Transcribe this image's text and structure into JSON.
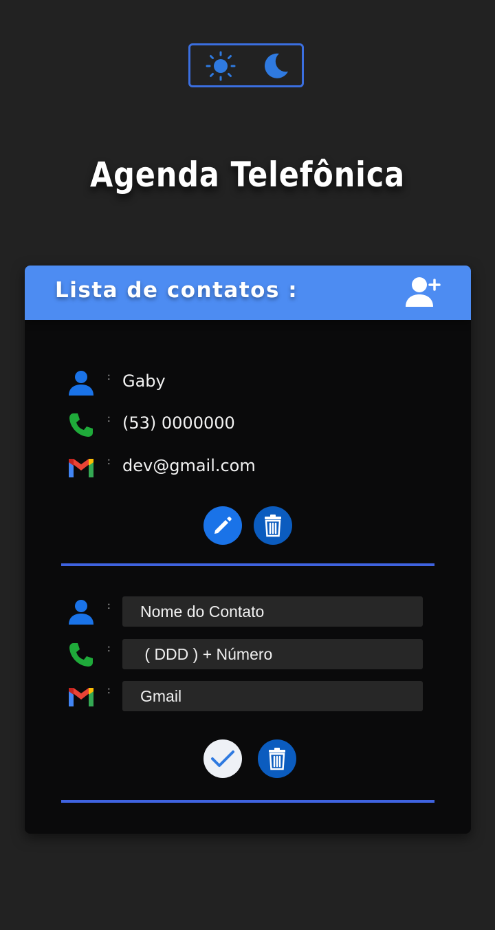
{
  "page": {
    "title": "Agenda Telefônica"
  },
  "theme_toggle": {
    "icons": [
      "sun-icon",
      "moon-icon"
    ]
  },
  "card": {
    "header_title": "Lista de contatos :",
    "add_icon": "user-plus-icon"
  },
  "contact": {
    "name": "Gaby",
    "phone": "(53) 0000000",
    "email": "dev@gmail.com",
    "separator": ":"
  },
  "new_contact_form": {
    "name_placeholder": "Nome do Contato",
    "phone_placeholder": " ( DDD ) + Número",
    "email_placeholder": "Gmail"
  },
  "colors": {
    "background": "#222222",
    "card": "#0a0a0b",
    "header": "#4d8cf2",
    "accent": "#1a73e8",
    "divider": "#3f63e0"
  }
}
